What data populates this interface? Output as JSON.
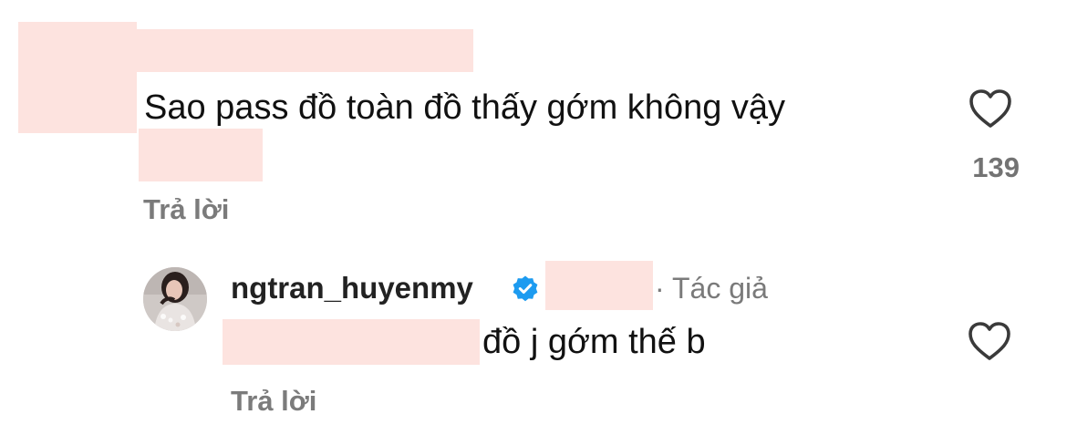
{
  "comments": [
    {
      "text": "Sao pass đồ toàn đồ thấy gớm không vậy",
      "reply_label": "Trả lời",
      "like_count": "139",
      "like_icon": "heart-outline-icon"
    },
    {
      "username": "ngtran_huyenmy",
      "verified_icon": "verified-badge-icon",
      "author_tag": "· Tác giả",
      "text": "đồ j gớm thế b",
      "reply_label": "Trả lời",
      "like_icon": "heart-outline-icon"
    }
  ],
  "colors": {
    "redaction": "#fde3df",
    "verified": "#1d9bf0",
    "muted_text": "#7b7b7b"
  }
}
